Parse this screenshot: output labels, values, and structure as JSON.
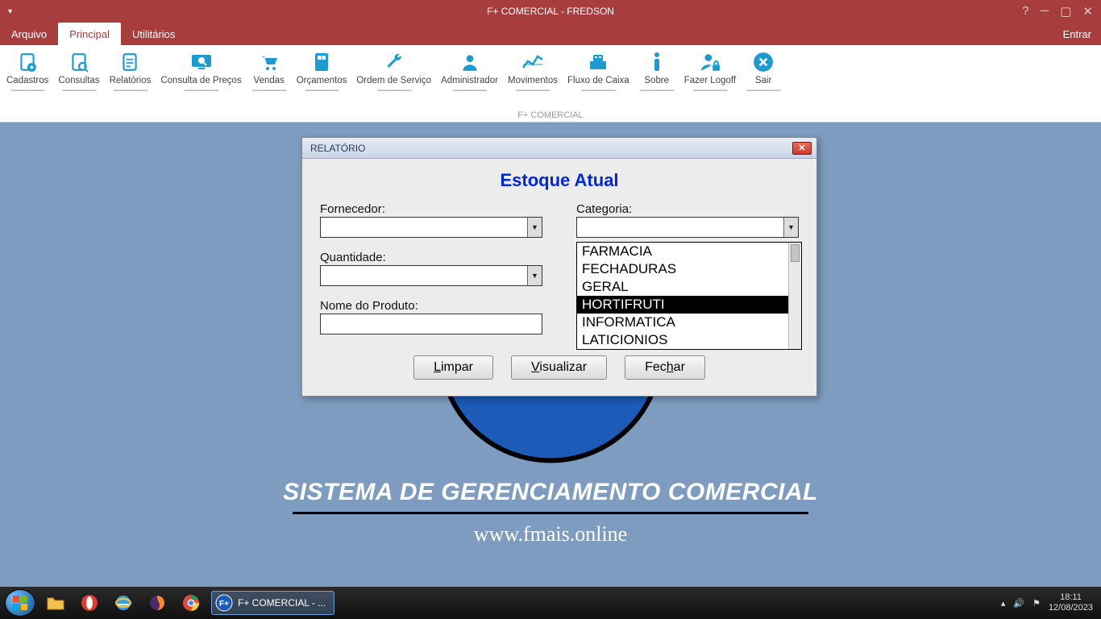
{
  "titlebar": {
    "title": "F+ COMERCIAL - FREDSON"
  },
  "menu": {
    "arquivo": "Arquivo",
    "principal": "Principal",
    "utilitarios": "Utilitários",
    "entrar": "Entrar"
  },
  "ribbon": {
    "caption": "F+ COMERCIAL",
    "items": {
      "cadastros": "Cadastros",
      "consultas": "Consultas",
      "relatorios": "Relatórios",
      "consulta_precos": "Consulta de Preços",
      "vendas": "Vendas",
      "orcamentos": "Orçamentos",
      "ordem_servico": "Ordem de Serviço",
      "administrador": "Administrador",
      "movimentos": "Movimentos",
      "fluxo_caixa": "Fluxo de Caixa",
      "sobre": "Sobre",
      "logoff": "Fazer Logoff",
      "sair": "Sair"
    },
    "drop": "------------------"
  },
  "desktop": {
    "slogan": "SISTEMA DE GERENCIAMENTO COMERCIAL",
    "url": "www.fmais.online"
  },
  "dialog": {
    "title": "RELATÓRIO",
    "heading": "Estoque Atual",
    "labels": {
      "fornecedor": "Fornecedor:",
      "categoria": "Categoria:",
      "quantidade": "Quantidade:",
      "nome_produto": "Nome do Produto:"
    },
    "values": {
      "fornecedor": "",
      "categoria": "",
      "quantidade": "",
      "nome_produto": ""
    },
    "buttons": {
      "limpar": "Limpar",
      "visualizar": "Visualizar",
      "fechar": "Fechar"
    },
    "categoria_options": [
      "FARMACIA",
      "FECHADURAS",
      "GERAL",
      "HORTIFRUTI",
      "INFORMATICA",
      "LATICIONIOS"
    ],
    "categoria_selected_index": 3
  },
  "taskbar": {
    "task_label": "F+ COMERCIAL - ...",
    "time": "18:11",
    "date": "12/08/2023"
  }
}
